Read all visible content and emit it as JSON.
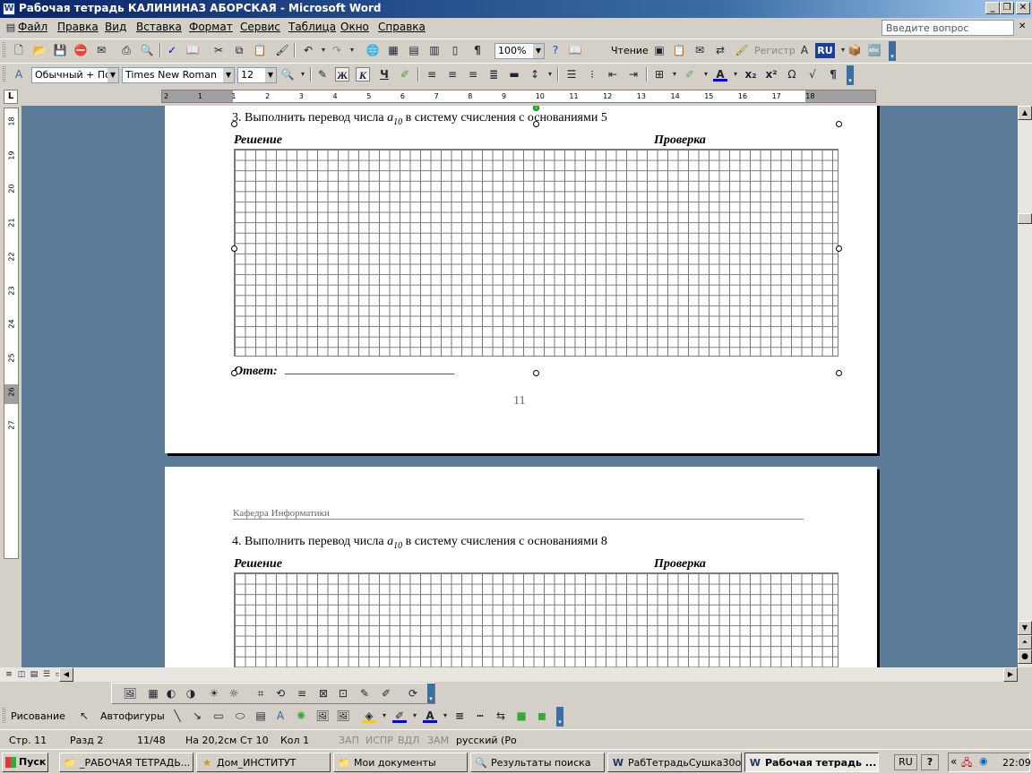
{
  "window": {
    "title": "Рабочая тетрадь  КАЛИНИНАЗ АБОРСКАЯ - Microsoft Word",
    "ask_placeholder": "Введите вопрос"
  },
  "menu": [
    "Файл",
    "Правка",
    "Вид",
    "Вставка",
    "Формат",
    "Сервис",
    "Таблица",
    "Окно",
    "Справка"
  ],
  "standard_toolbar": {
    "zoom": "100%",
    "read_label": "Чтение",
    "register_label": "Регистр",
    "lang_badge": "RU"
  },
  "formatting_toolbar": {
    "style": "Обычный + По ц",
    "font": "Times New Roman",
    "size": "12",
    "bold_label": "Ж",
    "italic_label": "К",
    "underline_label": "Ч"
  },
  "ruler": {
    "h_ticks": [
      "2",
      "1",
      "1",
      "2",
      "3",
      "4",
      "5",
      "6",
      "7",
      "8",
      "9",
      "10",
      "11",
      "12",
      "13",
      "14",
      "15",
      "16",
      "17",
      "18"
    ],
    "v_ticks": [
      "18",
      "19",
      "20",
      "21",
      "22",
      "23",
      "24",
      "25",
      "26",
      "27"
    ]
  },
  "page1": {
    "task": "3.    Выполнить перевод числа",
    "task_var": "a",
    "task_sub": "10",
    "task_rest": " в  систему счисления с основаниями 5",
    "solution_label": "Решение",
    "check_label": "Проверка",
    "answer_label": "Ответ:",
    "answer_line": "___________________________",
    "page_number": "11"
  },
  "page2": {
    "header": "Кафедра Информатики",
    "task": "4.    Выполнить перевод числа",
    "task_var": "a",
    "task_sub": "10",
    "task_rest": " в  систему счисления с основаниями  8",
    "solution_label": "Решение",
    "check_label": "Проверка"
  },
  "drawing_toolbar": {
    "draw_label": "Рисование",
    "autoshapes_label": "Автофигуры"
  },
  "status": {
    "page": "Стр. 11",
    "section": "Разд 2",
    "pages": "11/48",
    "at": "На 20,2см",
    "line": "Ст 10",
    "col": "Кол 1",
    "rec": "ЗАП",
    "trk": "ИСПР",
    "ext": "ВДЛ",
    "ovr": "ЗАМ",
    "lang": "русский (Ро"
  },
  "taskbar": {
    "start": "Пуск",
    "tasks": [
      "_РАБОЧАЯ ТЕТРАДЬ...",
      "Дом_ИНСТИТУТ",
      "Мои документы",
      "Результаты поиска",
      "РабТетрадьСушка30о...",
      "Рабочая тетрадь  ..."
    ],
    "lang": "RU",
    "time": "22:09"
  }
}
